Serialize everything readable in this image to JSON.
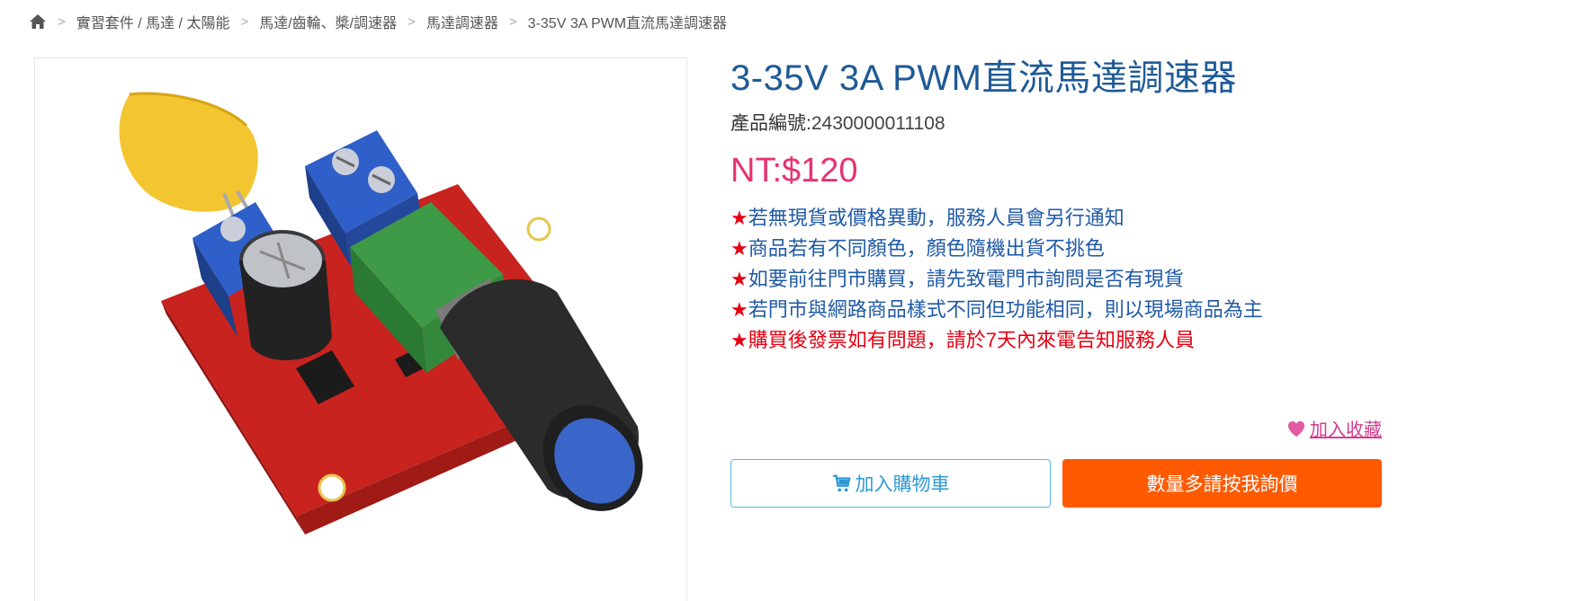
{
  "breadcrumb": {
    "items": [
      "實習套件 / 馬達 / 太陽能",
      "馬達/齒輪、槳/調速器",
      "馬達調速器",
      "3-35V 3A PWM直流馬達調速器"
    ],
    "separator": ">"
  },
  "product": {
    "title": "3-35V 3A PWM直流馬達調速器",
    "sku_label": "產品編號:",
    "sku_value": "2430000011108",
    "price": "NT:$120",
    "notes": [
      "若無現貨或價格異動，服務人員會另行通知",
      "商品若有不同顏色，顏色隨機出貨不挑色",
      "如要前往門市購買，請先致電門市詢問是否有現貨",
      "若門市與網路商品樣式不同但功能相同，則以現場商品為主",
      "購買後發票如有問題，請於7天內來電告知服務人員"
    ],
    "note_star": "★"
  },
  "actions": {
    "favorite_label": "加入收藏",
    "cart_label": "加入購物車",
    "inquiry_label": "數量多請按我詢價"
  },
  "icons": {
    "home": "home-icon",
    "heart": "heart-icon",
    "cart": "cart-icon"
  },
  "colors": {
    "title": "#1f5a96",
    "price": "#e8336f",
    "note_blue": "#1f5aa6",
    "note_red": "#e60012",
    "favorite": "#d23d8e",
    "cart_border": "#5bb8e0",
    "inquiry_bg": "#ff5a00"
  }
}
